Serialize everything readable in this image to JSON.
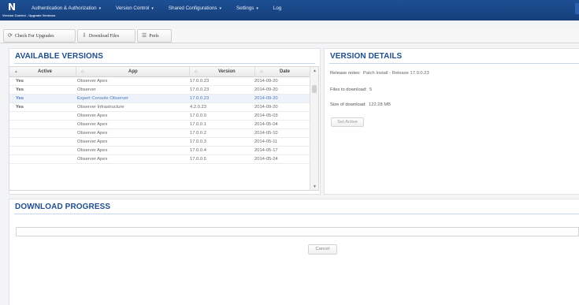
{
  "header": {
    "logo_letter": "N",
    "subtitle": "Version Control - Upgrade Versions",
    "nav": [
      {
        "label": "Authentication & Authorization",
        "has_dropdown": true
      },
      {
        "label": "Version Control",
        "has_dropdown": true
      },
      {
        "label": "Shared Configurations",
        "has_dropdown": true
      },
      {
        "label": "Settings",
        "has_dropdown": true
      },
      {
        "label": "Log",
        "has_dropdown": false
      }
    ]
  },
  "toolbar": {
    "check_upgrades": "Check For Upgrades",
    "download_files": "Download Files",
    "prefs": "Prefs"
  },
  "available_versions": {
    "title": "AVAILABLE VERSIONS",
    "columns": [
      "Active",
      "App",
      "Version",
      "Date"
    ],
    "rows": [
      {
        "active": "Yes",
        "app": "Observer Apex",
        "version": "17.0.0.23",
        "date": "2014-09-20",
        "selected": false
      },
      {
        "active": "Yes",
        "app": "Observer",
        "version": "17.0.0.23",
        "date": "2014-09-20",
        "selected": false
      },
      {
        "active": "Yes",
        "app": "Expert Console Observer",
        "version": "17.0.0.23",
        "date": "2014-09-20",
        "selected": true
      },
      {
        "active": "Yes",
        "app": "Observer Infrastructure",
        "version": "4.2.0.23",
        "date": "2014-09-20",
        "selected": false
      },
      {
        "active": "",
        "app": "Observer Apex",
        "version": "17.0.0.0",
        "date": "2014-05-03",
        "selected": false
      },
      {
        "active": "",
        "app": "Observer Apex",
        "version": "17.0.0.1",
        "date": "2014-05-04",
        "selected": false
      },
      {
        "active": "",
        "app": "Observer Apex",
        "version": "17.0.0.2",
        "date": "2014-05-10",
        "selected": false
      },
      {
        "active": "",
        "app": "Observer Apex",
        "version": "17.0.0.3",
        "date": "2014-05-11",
        "selected": false
      },
      {
        "active": "",
        "app": "Observer Apex",
        "version": "17.0.0.4",
        "date": "2014-05-17",
        "selected": false
      },
      {
        "active": "",
        "app": "Observer Apex",
        "version": "17.0.0.5",
        "date": "2014-05-24",
        "selected": false
      }
    ]
  },
  "version_details": {
    "title": "VERSION DETAILS",
    "release_notes_label": "Release notes:",
    "release_notes_value": "Patch Install - Release 17.0.0.23",
    "files_label": "Files to download:",
    "files_value": "5",
    "size_label": "Size of download:",
    "size_value": "122.28 MB",
    "set_active": "Set Active"
  },
  "download_progress": {
    "title": "DOWNLOAD PROGRESS",
    "cancel": "Cancel"
  },
  "colors": {
    "header_bg": "#1a4a8c",
    "section_title": "#1f4e8c",
    "selected_row_text": "#4a78b8"
  }
}
